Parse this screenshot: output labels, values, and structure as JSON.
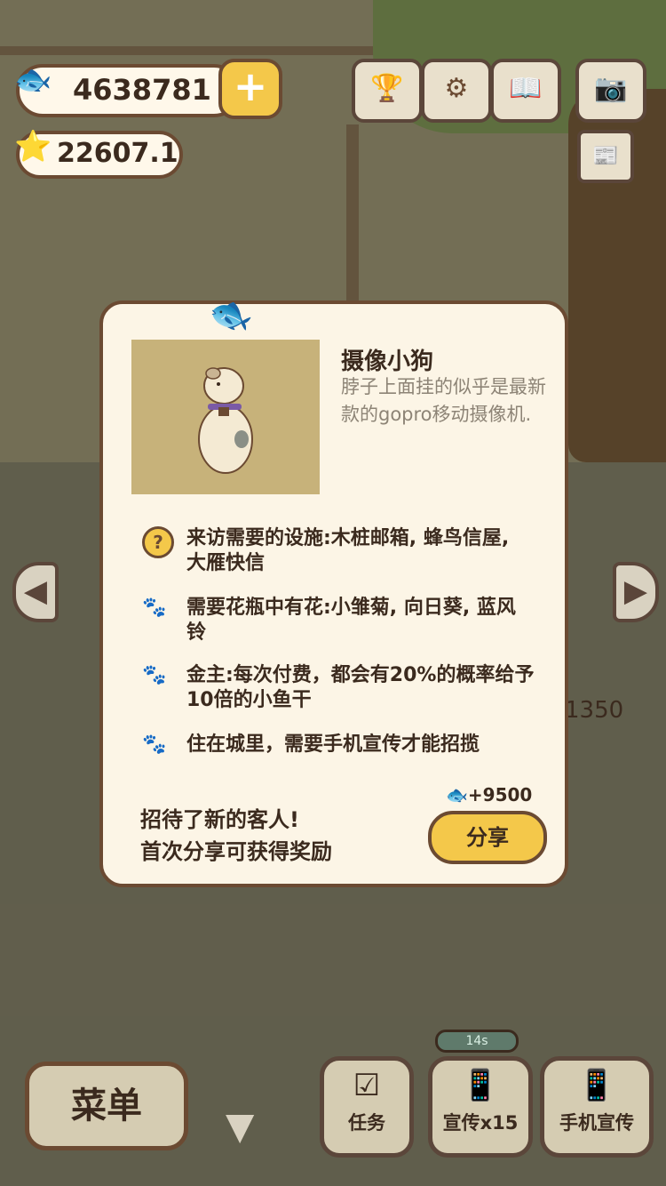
{
  "hud": {
    "fish_value": "4638781",
    "star_value": "22607.1",
    "price_label": "1350"
  },
  "colors": {
    "accent": "#f4c84a",
    "panel": "#fcf5e6",
    "outline": "#6b4a32",
    "text": "#3b2a1e"
  },
  "icons": {
    "fish": "fish-icon",
    "star": "star-icon",
    "plus": "plus-icon",
    "ranking": "ranking-icon",
    "settings": "gear-icon",
    "book": "book-icon",
    "camera": "camera-icon",
    "notice": "notice-icon",
    "question": "question-icon",
    "paw": "paw-icon"
  },
  "modal": {
    "character_name": "摄像小狗",
    "character_desc": "脖子上面挂的似乎是最新款的gopro移动摄像机.",
    "requirements": [
      {
        "icon": "question-icon",
        "text": "来访需要的设施:木桩邮箱, 蜂鸟信屋, 大雁快信"
      },
      {
        "icon": "paw-icon",
        "text": "需要花瓶中有花:小雏菊, 向日葵, 蓝风铃"
      },
      {
        "icon": "paw-icon",
        "text": "金主:每次付费，都会有20%的概率给予10倍的小鱼干"
      },
      {
        "icon": "paw-icon",
        "text": "住在城里，需要手机宣传才能招揽"
      }
    ],
    "reward": "+9500",
    "welcome_line1": "招待了新的客人!",
    "welcome_line2": "首次分享可获得奖励",
    "share_label": "分享"
  },
  "bottom": {
    "menu_label": "菜单",
    "tasks_label": "任务",
    "promo_label": "宣传x15",
    "promo_timer": "14s",
    "phone_promo_label": "手机宣传"
  }
}
